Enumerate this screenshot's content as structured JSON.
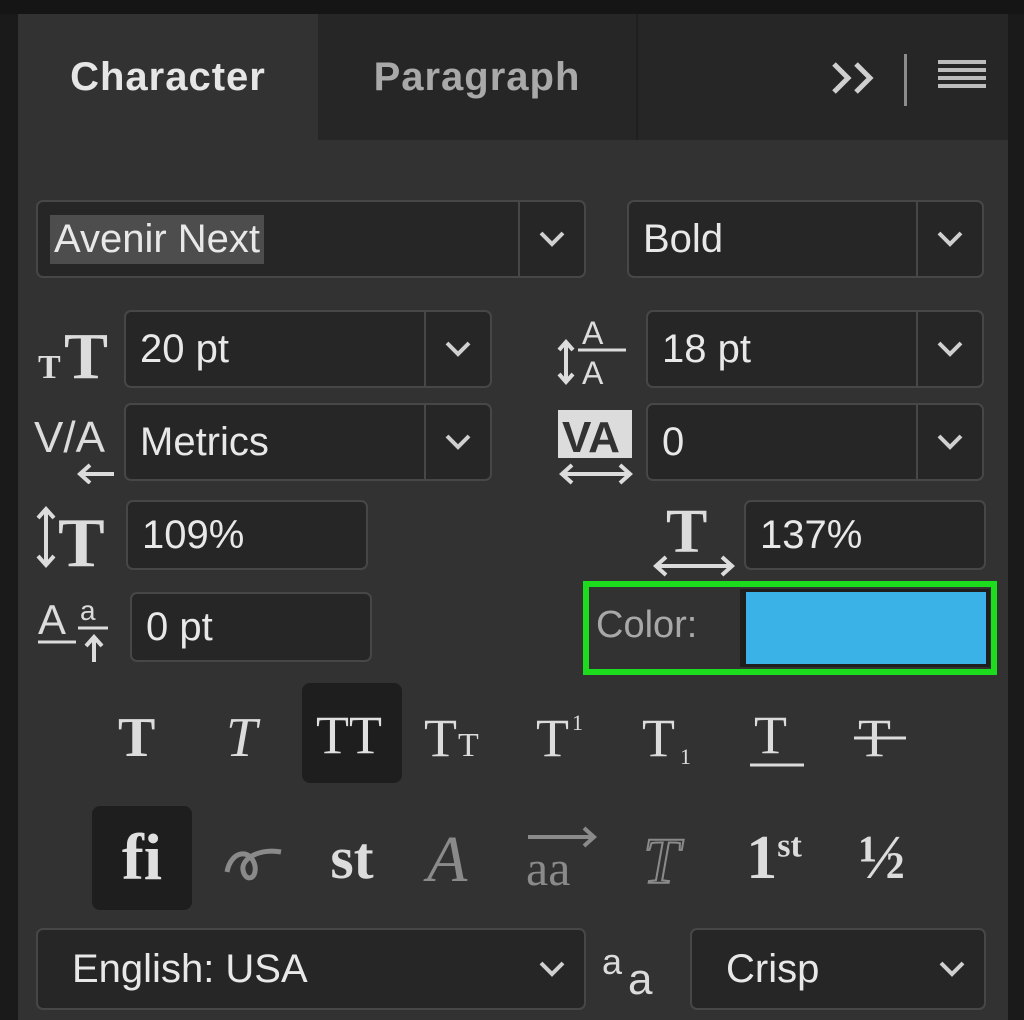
{
  "tabs": [
    {
      "label": "Character",
      "active": true
    },
    {
      "label": "Paragraph",
      "active": false
    }
  ],
  "font_family": {
    "value": "Avenir Next"
  },
  "font_style": {
    "value": "Bold"
  },
  "font_size": {
    "value": "20 pt",
    "icon": "font-size-icon"
  },
  "leading": {
    "value": "18 pt",
    "icon": "leading-icon"
  },
  "kerning": {
    "value": "Metrics",
    "icon": "kerning-icon"
  },
  "tracking": {
    "value": "0",
    "icon": "tracking-icon"
  },
  "vertical_scale": {
    "value": "109%",
    "icon": "vertical-scale-icon"
  },
  "horizontal_scale": {
    "value": "137%",
    "icon": "horizontal-scale-icon"
  },
  "baseline_shift": {
    "value": "0 pt",
    "icon": "baseline-shift-icon"
  },
  "color": {
    "label": "Color:",
    "value": "#3ab2e8",
    "highlight": "#1ddc1d"
  },
  "style_buttons": [
    {
      "name": "faux-bold",
      "active": false
    },
    {
      "name": "faux-italic",
      "active": false
    },
    {
      "name": "all-caps",
      "active": true
    },
    {
      "name": "small-caps",
      "active": false
    },
    {
      "name": "superscript",
      "active": false
    },
    {
      "name": "subscript",
      "active": false
    },
    {
      "name": "underline",
      "active": false
    },
    {
      "name": "strikethrough",
      "active": false
    }
  ],
  "opentype_buttons": [
    {
      "name": "standard-ligatures",
      "label": "fi",
      "active": true
    },
    {
      "name": "contextual-alternates",
      "active": false
    },
    {
      "name": "discretionary-ligatures",
      "label": "st",
      "active": false
    },
    {
      "name": "swash",
      "active": false
    },
    {
      "name": "stylistic-alternates",
      "label": "aa",
      "active": false
    },
    {
      "name": "titling-alternates",
      "active": false
    },
    {
      "name": "ordinals",
      "label": "1st",
      "active": false
    },
    {
      "name": "fractions",
      "label": "½",
      "active": false
    }
  ],
  "language": {
    "value": "English: USA"
  },
  "anti_alias": {
    "value": "Crisp",
    "icon": "anti-alias-icon"
  }
}
